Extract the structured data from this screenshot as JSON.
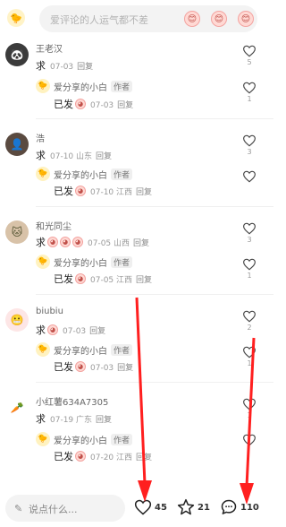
{
  "search": {
    "placeholder": "爱评论的人运气都不差"
  },
  "top_emojis": [
    "😊",
    "😊",
    "😊"
  ],
  "comments": [
    {
      "username": "王老汉",
      "text": "求",
      "emoji_count": 0,
      "date": "07-03",
      "location": "",
      "reply_label": "回复",
      "likes": "5",
      "reply": {
        "username": "爱分享的小白",
        "badge": "作者",
        "text": "已发",
        "date": "07-03",
        "location": "",
        "reply_label": "回复",
        "likes": "1"
      }
    },
    {
      "username": "浩",
      "text": "求",
      "emoji_count": 0,
      "date": "07-10",
      "location": "山东",
      "reply_label": "回复",
      "likes": "3",
      "reply": {
        "username": "爱分享的小白",
        "badge": "作者",
        "text": "已发",
        "date": "07-10",
        "location": "江西",
        "reply_label": "回复",
        "likes": ""
      }
    },
    {
      "username": "和光同尘",
      "text": "求",
      "emoji_count": 3,
      "date": "07-05",
      "location": "山西",
      "reply_label": "回复",
      "likes": "3",
      "reply": {
        "username": "爱分享的小白",
        "badge": "作者",
        "text": "已发",
        "date": "07-05",
        "location": "江西",
        "reply_label": "回复",
        "likes": "1"
      }
    },
    {
      "username": "biubiu",
      "text": "求",
      "emoji_count": 1,
      "date": "07-03",
      "location": "",
      "reply_label": "回复",
      "likes": "2",
      "reply": {
        "username": "爱分享的小白",
        "badge": "作者",
        "text": "已发",
        "date": "07-03",
        "location": "",
        "reply_label": "回复",
        "likes": "1"
      }
    },
    {
      "username": "小红薯634A7305",
      "text": "求",
      "emoji_count": 0,
      "date": "07-19",
      "location": "广东",
      "reply_label": "回复",
      "likes": "1",
      "reply": {
        "username": "爱分享的小白",
        "badge": "作者",
        "text": "已发",
        "date": "07-20",
        "location": "江西",
        "reply_label": "回复",
        "likes": ""
      }
    }
  ],
  "bottom": {
    "input_placeholder": "说点什么...",
    "likes": "45",
    "stars": "21",
    "comments": "110"
  },
  "colors": {
    "arrow": "#ff1f1f",
    "accent_emoji": "#ffd9d4"
  },
  "icons": [
    "pencil-icon",
    "heart-icon",
    "star-icon",
    "comment-icon"
  ]
}
